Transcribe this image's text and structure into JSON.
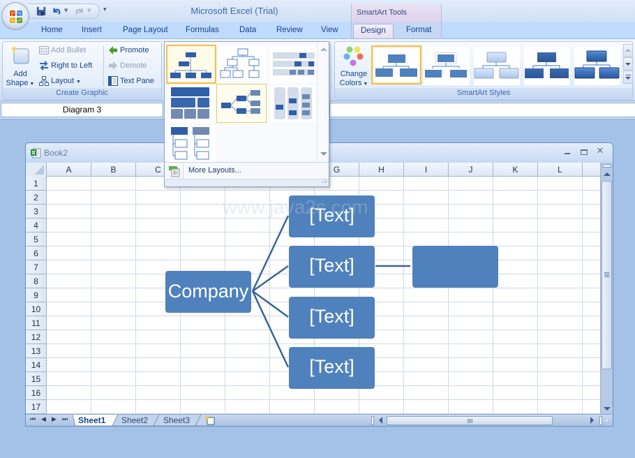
{
  "title_bar": {
    "app_title": "Microsoft Excel (Trial)",
    "context_tab_group": "SmartArt Tools",
    "quick_access": [
      {
        "name": "save",
        "icon": "floppy-disk-icon"
      },
      {
        "name": "undo",
        "icon": "undo-icon"
      },
      {
        "name": "redo",
        "icon": "redo-icon"
      }
    ],
    "customize_label": "▾"
  },
  "tabs": [
    {
      "label": "Home"
    },
    {
      "label": "Insert"
    },
    {
      "label": "Page Layout"
    },
    {
      "label": "Formulas"
    },
    {
      "label": "Data"
    },
    {
      "label": "Review"
    },
    {
      "label": "View"
    },
    {
      "label": "Design",
      "active": true,
      "contextual": true
    },
    {
      "label": "Format",
      "contextual": true
    }
  ],
  "ribbon": {
    "create_graphic": {
      "label": "Create Graphic",
      "add_shape_line1": "Add",
      "add_shape_line2": "Shape",
      "add_bullet": "Add Bullet",
      "right_to_left": "Right to Left",
      "layout": "Layout",
      "promote": "Promote",
      "demote": "Demote",
      "text_pane": "Text Pane"
    },
    "layouts_gallery": {
      "items": [
        {
          "name": "Organization Chart",
          "selected": true
        },
        {
          "name": "Hierarchy"
        },
        {
          "name": "Labeled Hierarchy"
        },
        {
          "name": "Table Hierarchy"
        },
        {
          "name": "Horizontal Hierarchy",
          "hover": true
        },
        {
          "name": "Horizontal Labeled Hierarchy"
        },
        {
          "name": "Hierarchy List"
        }
      ],
      "more_layouts": "More Layouts..."
    },
    "change_colors_line1": "Change",
    "change_colors_line2": "Colors",
    "smartart_styles": {
      "label": "SmartArt Styles",
      "items": [
        {
          "name": "Simple Fill",
          "selected": true
        },
        {
          "name": "White Outline"
        },
        {
          "name": "Subtle Effect"
        },
        {
          "name": "Moderate Effect"
        },
        {
          "name": "Intense Effect"
        }
      ]
    }
  },
  "formula_bar": {
    "name_box": "Diagram 3",
    "formula": ""
  },
  "workbook": {
    "title": "Book2",
    "columns": [
      "A",
      "B",
      "C",
      "D",
      "E",
      "F",
      "G",
      "H",
      "I",
      "J",
      "K",
      "L"
    ],
    "rows": [
      "1",
      "2",
      "3",
      "4",
      "5",
      "6",
      "7",
      "8",
      "9",
      "10",
      "11",
      "12",
      "13",
      "14",
      "15",
      "16",
      "17"
    ],
    "sheets": [
      {
        "label": "Sheet1",
        "active": true
      },
      {
        "label": "Sheet2"
      },
      {
        "label": "Sheet3"
      }
    ]
  },
  "smartart": {
    "root": "Company",
    "children": [
      "[Text]",
      "[Text]",
      "[Text]",
      "[Text]"
    ],
    "grandchild": "",
    "fill_color": "#4f81bd",
    "connector_color": "#3c6596",
    "watermark": "www.java2s.com"
  },
  "colors": {
    "accent": "#4f81bd",
    "window_bg": "#a4c2e8",
    "tab_text": "#15428b",
    "selection_gold": "#f3bd4a"
  }
}
